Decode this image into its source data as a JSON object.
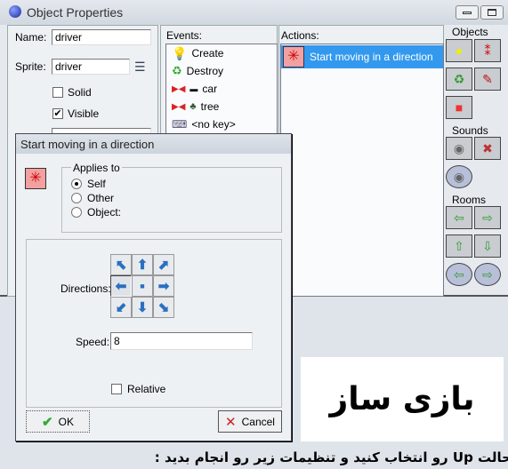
{
  "window": {
    "title": "Object Properties",
    "minimize_icon": "minimize-icon",
    "restore_icon": "restore-icon"
  },
  "properties": {
    "name_label": "Name:",
    "name_value": "driver",
    "sprite_label": "Sprite:",
    "sprite_value": "driver",
    "solid_label": "Solid",
    "solid_checked": false,
    "visible_label": "Visible",
    "visible_checked": true
  },
  "events": {
    "label": "Events:",
    "items": [
      {
        "label": "Create",
        "icon": "lightbulb-icon"
      },
      {
        "label": "Destroy",
        "icon": "trash-icon"
      },
      {
        "label": "car",
        "icon": "collision-icon"
      },
      {
        "label": "tree",
        "icon": "collision-icon"
      },
      {
        "label": "<no key>",
        "icon": "keyboard-icon"
      }
    ]
  },
  "actions": {
    "label": "Actions:",
    "items": [
      {
        "label": "Start moving in a direction",
        "selected": true
      }
    ]
  },
  "toolbar": {
    "objects_label": "Objects",
    "sounds_label": "Sounds",
    "rooms_label": "Rooms"
  },
  "dialog": {
    "title": "Start moving in a direction",
    "applies_to_label": "Applies to",
    "options": [
      "Self",
      "Other",
      "Object:"
    ],
    "selected_option": "Self",
    "directions_label": "Directions:",
    "selected_direction": "left",
    "speed_label": "Speed:",
    "speed_value": "8",
    "relative_label": "Relative",
    "relative_checked": false,
    "ok_label": "OK",
    "cancel_label": "Cancel"
  },
  "overlay": {
    "logo_text": "بازی ساز",
    "caption": "حالت Up رو انتخاب کنید و تنظیمات زیر رو انجام بدید :"
  },
  "colors": {
    "selection": "#3399ee",
    "accent": "#2a6fc0"
  }
}
